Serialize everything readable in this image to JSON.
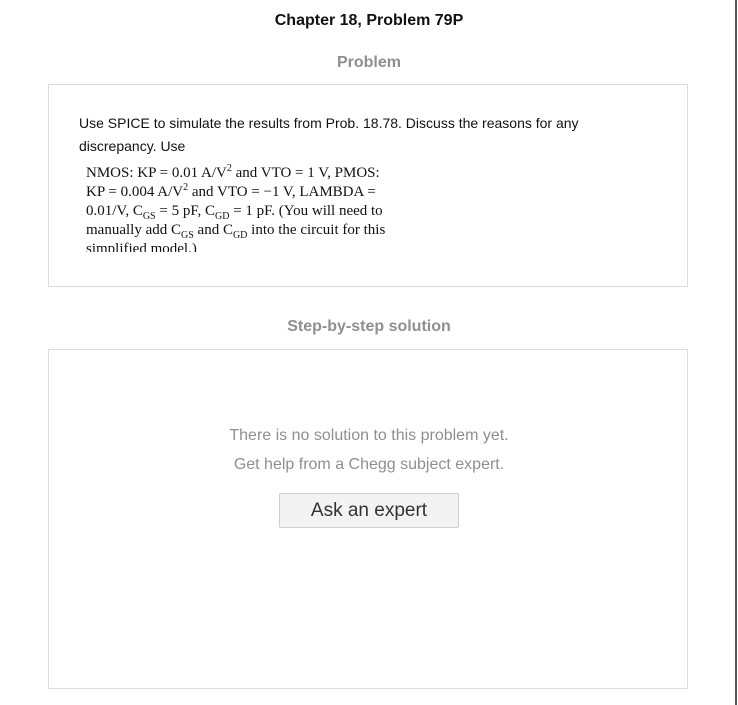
{
  "header": {
    "title": "Chapter 18, Problem 79P"
  },
  "problem": {
    "heading": "Problem",
    "text": "Use SPICE to simulate the results from Prob. 18.78. Discuss the reasons for any discrepancy. Use",
    "image_lines": [
      "NMOS: KP = 0.01 A/V² and VTO = 1 V, PMOS:",
      "KP = 0.004 A/V² and VTO = −1 V, LAMBDA =",
      "0.01/V, C_GS = 5 pF, C_GD = 1 pF. (You will need to",
      "manually add C_GS and C_GD into the circuit for this",
      "simplified model.)"
    ]
  },
  "solution": {
    "heading": "Step-by-step solution",
    "empty_message": "There is no solution to this problem yet.",
    "help_message": "Get help from a Chegg subject expert.",
    "button_label": "Ask an expert"
  }
}
